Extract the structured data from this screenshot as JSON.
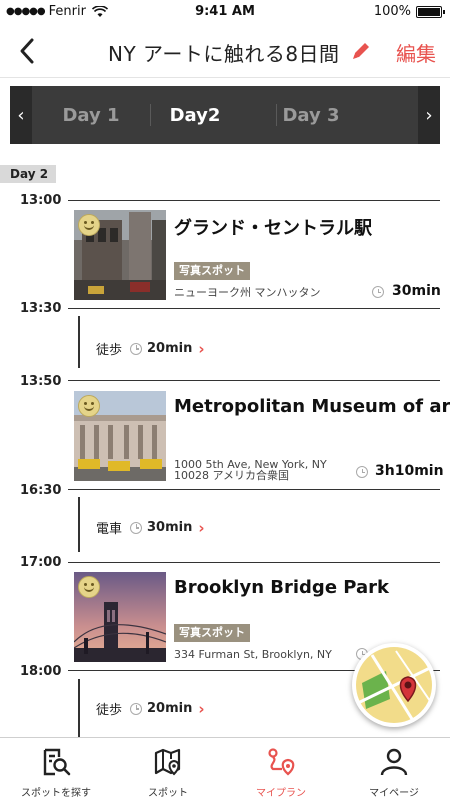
{
  "status_bar": {
    "carrier": "Fenrir",
    "time": "9:41 AM",
    "battery": "100%"
  },
  "header": {
    "title": "NY アートに触れる8日間",
    "edit_label": "編集"
  },
  "day_tabs": {
    "items": [
      "Day 1",
      "Day2",
      "Day 3"
    ],
    "active_index": 1
  },
  "day_badge": "Day 2",
  "timeline": {
    "times": [
      "13:00",
      "13:30",
      "13:50",
      "16:30",
      "17:00",
      "18:00"
    ],
    "spots": [
      {
        "title": "グランド・セントラル駅",
        "tag": "写真スポット",
        "address": "ニューヨーク州 マンハッタン",
        "duration": "30min"
      },
      {
        "title": "Metropolitan Museum of art",
        "tag": "",
        "address_line1": "1000 5th Ave, New York, NY",
        "address_line2": "10028 アメリカ合衆国",
        "duration": "3h10min"
      },
      {
        "title": "Brooklyn Bridge Park",
        "tag": "写真スポット",
        "address": "334 Furman St, Brooklyn, NY"
      }
    ],
    "moves": [
      {
        "mode": "徒歩",
        "duration": "20min"
      },
      {
        "mode": "電車",
        "duration": "30min"
      },
      {
        "mode": "徒歩",
        "duration": "20min"
      }
    ]
  },
  "tabbar": {
    "items": [
      "スポットを探す",
      "スポット",
      "マイプラン",
      "マイページ"
    ],
    "active_index": 2
  },
  "colors": {
    "accent": "#e8534f",
    "tab_bg": "#3b3b3b",
    "tag_bg": "#9a917f"
  }
}
